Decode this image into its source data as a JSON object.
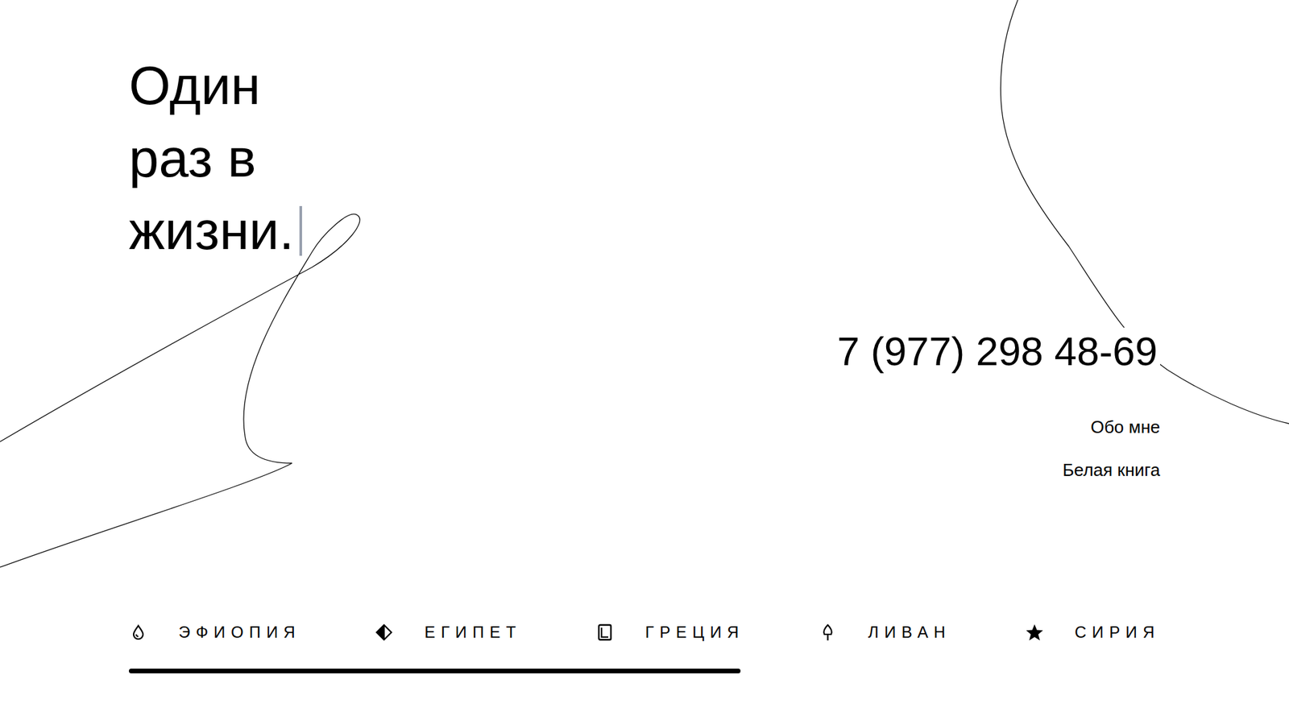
{
  "hero": {
    "lines": [
      "Один",
      "раз в",
      "жизни."
    ]
  },
  "contact": {
    "phone": "7 (977) 298 48-69"
  },
  "links": [
    {
      "label": "Обо мне"
    },
    {
      "label": "Белая книга"
    }
  ],
  "nav": {
    "items": [
      {
        "label": "ЭФИОПИЯ",
        "kind": "drop"
      },
      {
        "label": "ЕГИПЕТ",
        "kind": "diamond"
      },
      {
        "label": "ГРЕЦИЯ",
        "kind": "book"
      },
      {
        "label": "ЛИВАН",
        "kind": "tree"
      },
      {
        "label": "СИРИЯ",
        "kind": "star"
      }
    ],
    "progress": {
      "level": 0.593
    }
  }
}
